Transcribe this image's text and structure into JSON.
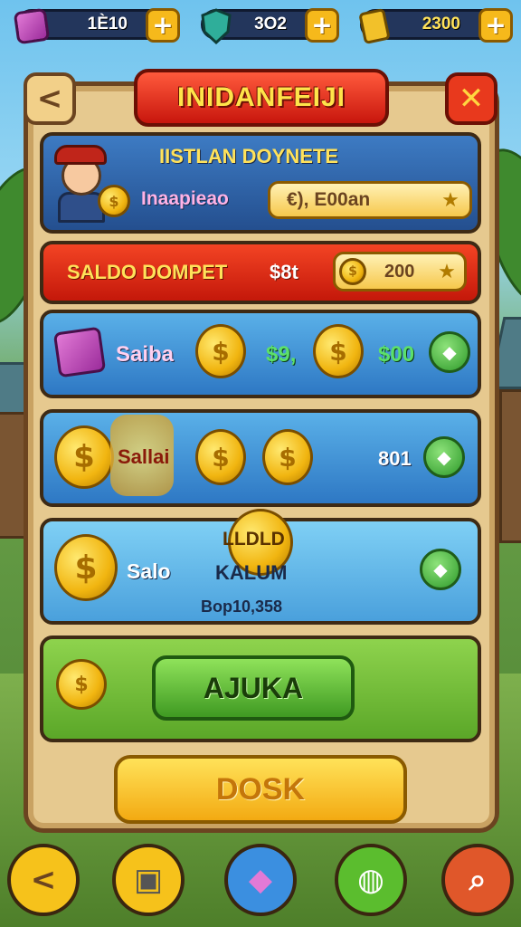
{
  "top_bar": {
    "resources": [
      {
        "icon": "gem-box-icon",
        "value": "1Ѐ10"
      },
      {
        "icon": "shield-gem-icon",
        "value": "3О2"
      },
      {
        "icon": "ticket-icon",
        "value": "2300"
      }
    ],
    "plus_label": "+"
  },
  "header": {
    "title": "INIDANFEIJI",
    "back_label": "<",
    "close_label": "✕"
  },
  "profile": {
    "heading": "IISTLAN DOYNETE",
    "name": "Inaapieao",
    "balance": "€), E00an"
  },
  "wallet": {
    "label": "SALDO DOMPET",
    "amount": "$8t",
    "pill_value": "200"
  },
  "offers": [
    {
      "label": "Saiba",
      "value_left": "$9,",
      "value_right": "$00"
    },
    {
      "label": "Sallai",
      "value_right": "801"
    },
    {
      "label": "Salo",
      "promo_line1": "LLDLD",
      "promo_line2": "KALUM",
      "footer": "Bop10,358"
    }
  ],
  "actions": {
    "accept_label": "AJUKA",
    "bottom_label": "DOSK"
  },
  "nav": [
    {
      "icon": "back-arrow-icon",
      "label": "<",
      "color": "#f6c21b"
    },
    {
      "icon": "inventory-icon",
      "label": "▣",
      "color": "#f6c21b"
    },
    {
      "icon": "gem-cube-icon",
      "label": "◆",
      "color": "#3b8fe0"
    },
    {
      "icon": "shop-bowl-icon",
      "label": "◍",
      "color": "#5bbd2e"
    },
    {
      "icon": "search-icon",
      "label": "⌕",
      "color": "#e0572a"
    }
  ],
  "colors": {
    "panel": "#e6c98f",
    "title_banner": "#e0261a",
    "accept": "#5ba728",
    "gold": "#f6b91b"
  }
}
